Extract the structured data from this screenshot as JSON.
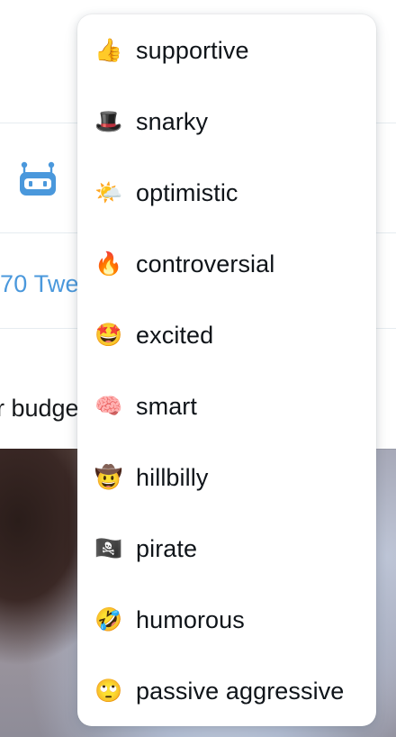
{
  "background": {
    "tweet_count_fragment": "70 Twe",
    "text_fragment": "r budge"
  },
  "icons": {
    "bot": "robot-icon"
  },
  "colors": {
    "link_blue": "#4a98dc",
    "text": "#0f1419",
    "divider": "#e6ecf0"
  },
  "tone_menu": {
    "items": [
      {
        "emoji": "👍",
        "icon": "thumbs-up-icon",
        "label": "supportive"
      },
      {
        "emoji": "🎩",
        "icon": "top-hat-icon",
        "label": "snarky"
      },
      {
        "emoji": "🌤️",
        "icon": "sun-behind-cloud-icon",
        "label": "optimistic"
      },
      {
        "emoji": "🔥",
        "icon": "fire-icon",
        "label": "controversial"
      },
      {
        "emoji": "🤩",
        "icon": "star-struck-icon",
        "label": "excited"
      },
      {
        "emoji": "🧠",
        "icon": "brain-icon",
        "label": "smart"
      },
      {
        "emoji": "🤠",
        "icon": "cowboy-hat-face-icon",
        "label": "hillbilly"
      },
      {
        "emoji": "🏴‍☠️",
        "icon": "pirate-flag-icon",
        "label": "pirate"
      },
      {
        "emoji": "🤣",
        "icon": "rolling-laughing-icon",
        "label": "humorous"
      },
      {
        "emoji": "🙄",
        "icon": "eye-roll-icon",
        "label": "passive aggressive"
      }
    ]
  }
}
